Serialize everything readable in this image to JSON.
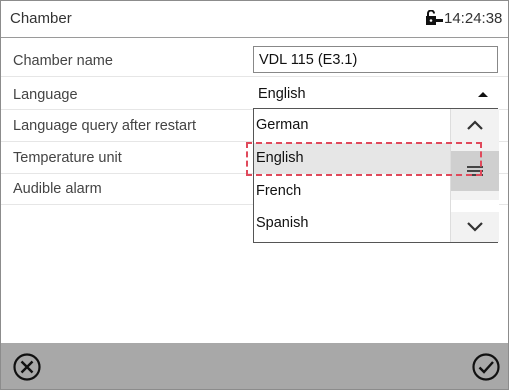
{
  "header": {
    "title": "Chamber",
    "time": "14:24:38",
    "icon": "lock-icon"
  },
  "rows": [
    {
      "label": "Chamber name"
    },
    {
      "label": "Language"
    },
    {
      "label": "Language query after restart"
    },
    {
      "label": "Temperature unit"
    },
    {
      "label": "Audible alarm"
    }
  ],
  "chamber_name": {
    "value": "VDL 115 (E3.1)"
  },
  "language": {
    "selected": "English",
    "options": [
      "German",
      "English",
      "French",
      "Spanish"
    ],
    "highlighted_index": 1
  },
  "footer": {
    "cancel_icon": "cancel-icon",
    "confirm_icon": "confirm-icon"
  },
  "colors": {
    "footer_bg": "#a8a8a8",
    "selection_outline": "#e0495b",
    "selection_bg": "#e6e6e6"
  }
}
